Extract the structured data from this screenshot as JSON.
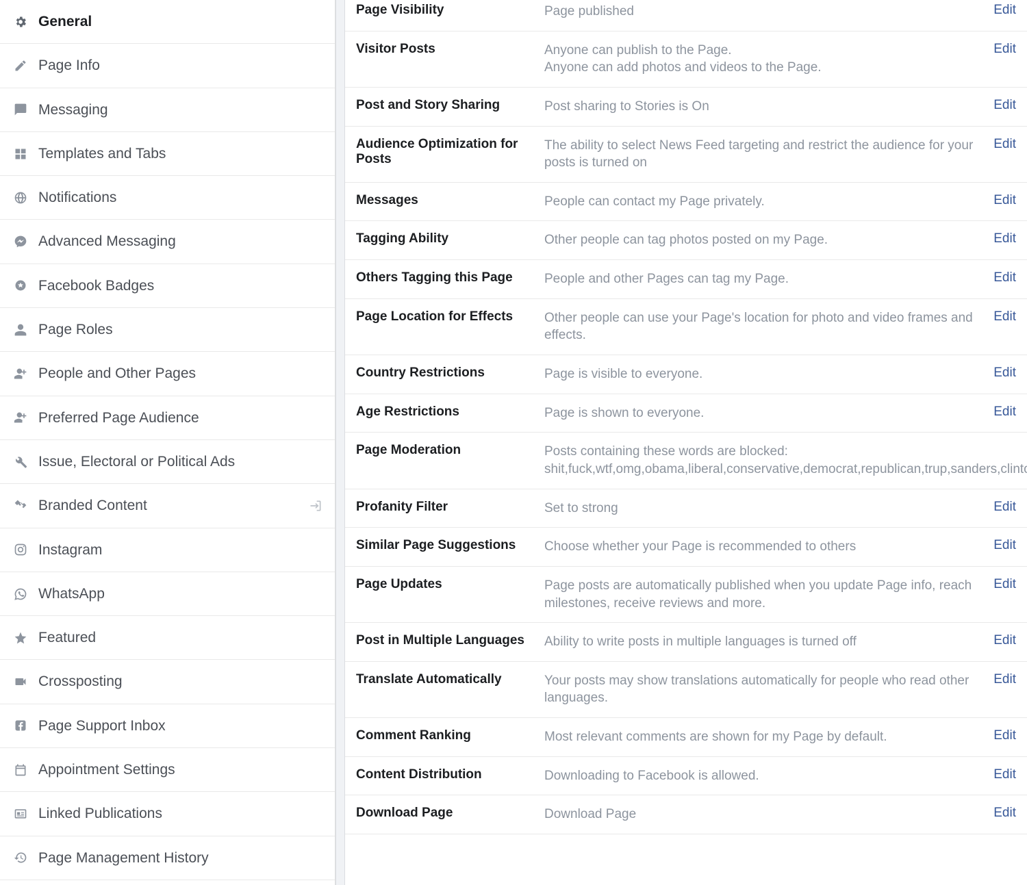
{
  "edit_label": "Edit",
  "sidebar": {
    "items": [
      {
        "label": "General",
        "icon": "gear-icon",
        "active": true
      },
      {
        "label": "Page Info",
        "icon": "pencil-icon"
      },
      {
        "label": "Messaging",
        "icon": "chat-icon"
      },
      {
        "label": "Templates and Tabs",
        "icon": "grid-icon"
      },
      {
        "label": "Notifications",
        "icon": "globe-icon"
      },
      {
        "label": "Advanced Messaging",
        "icon": "messenger-icon"
      },
      {
        "label": "Facebook Badges",
        "icon": "badge-icon"
      },
      {
        "label": "Page Roles",
        "icon": "person-icon"
      },
      {
        "label": "People and Other Pages",
        "icon": "person-plus-icon"
      },
      {
        "label": "Preferred Page Audience",
        "icon": "person-plus-icon"
      },
      {
        "label": "Issue, Electoral or Political Ads",
        "icon": "wrench-icon"
      },
      {
        "label": "Branded Content",
        "icon": "handshake-icon",
        "trailing": true
      },
      {
        "label": "Instagram",
        "icon": "instagram-icon"
      },
      {
        "label": "WhatsApp",
        "icon": "whatsapp-icon"
      },
      {
        "label": "Featured",
        "icon": "star-icon"
      },
      {
        "label": "Crossposting",
        "icon": "camera-icon"
      },
      {
        "label": "Page Support Inbox",
        "icon": "fb-icon"
      },
      {
        "label": "Appointment Settings",
        "icon": "calendar-icon"
      },
      {
        "label": "Linked Publications",
        "icon": "news-icon"
      },
      {
        "label": "Page Management History",
        "icon": "history-icon"
      }
    ]
  },
  "settings": [
    {
      "label": "Page Visibility",
      "desc": "Page published"
    },
    {
      "label": "Visitor Posts",
      "desc": "Anyone can publish to the Page.\nAnyone can add photos and videos to the Page."
    },
    {
      "label": "Post and Story Sharing",
      "desc": "Post sharing to Stories is On"
    },
    {
      "label": "Audience Optimization for Posts",
      "desc": "The ability to select News Feed targeting and restrict the audience for your posts is turned on"
    },
    {
      "label": "Messages",
      "desc": "People can contact my Page privately."
    },
    {
      "label": "Tagging Ability",
      "desc": "Other people can tag photos posted on my Page."
    },
    {
      "label": "Others Tagging this Page",
      "desc": "People and other Pages can tag my Page."
    },
    {
      "label": "Page Location for Effects",
      "desc": "Other people can use your Page's location for photo and video frames and effects."
    },
    {
      "label": "Country Restrictions",
      "desc": "Page is visible to everyone."
    },
    {
      "label": "Age Restrictions",
      "desc": "Page is shown to everyone."
    },
    {
      "label": "Page Moderation",
      "desc": "Posts containing these words are blocked: shit,fuck,wtf,omg,obama,liberal,conservative,democrat,republican,trup,sanders,clinton,cruz"
    },
    {
      "label": "Profanity Filter",
      "desc": "Set to strong"
    },
    {
      "label": "Similar Page Suggestions",
      "desc": "Choose whether your Page is recommended to others"
    },
    {
      "label": "Page Updates",
      "desc": "Page posts are automatically published when you update Page info, reach milestones, receive reviews and more."
    },
    {
      "label": "Post in Multiple Languages",
      "desc": "Ability to write posts in multiple languages is turned off"
    },
    {
      "label": "Translate Automatically",
      "desc": "Your posts may show translations automatically for people who read other languages."
    },
    {
      "label": "Comment Ranking",
      "desc": "Most relevant comments are shown for my Page by default."
    },
    {
      "label": "Content Distribution",
      "desc": "Downloading to Facebook is allowed."
    },
    {
      "label": "Download Page",
      "desc": "Download Page"
    }
  ]
}
